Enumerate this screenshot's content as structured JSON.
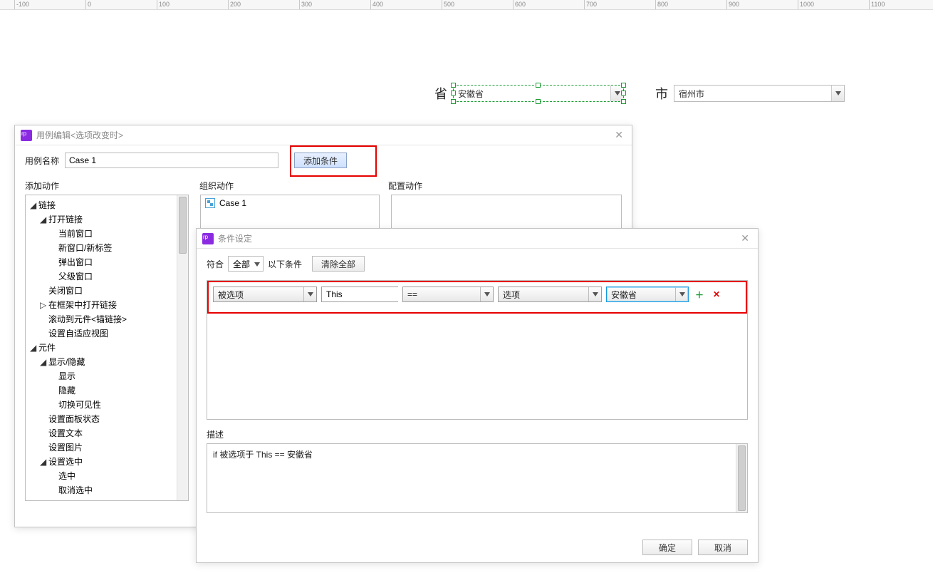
{
  "ruler": {
    "start": -100,
    "step": 100,
    "count": 16
  },
  "canvas": {
    "left": {
      "label": "省",
      "value": "安徽省"
    },
    "right": {
      "label": "市",
      "value": "宿州市"
    }
  },
  "caseDialog": {
    "title": "用例编辑<选项改变时>",
    "nameLabel": "用例名称",
    "nameValue": "Case 1",
    "addConditionBtn": "添加条件",
    "headers": {
      "a": "添加动作",
      "b": "组织动作",
      "c": "配置动作"
    },
    "tree": [
      {
        "label": "链接",
        "exp": true,
        "children": [
          {
            "label": "打开链接",
            "exp": true,
            "children": [
              {
                "label": "当前窗口"
              },
              {
                "label": "新窗口/新标签"
              },
              {
                "label": "弹出窗口"
              },
              {
                "label": "父级窗口"
              }
            ]
          },
          {
            "label": "关闭窗口"
          },
          {
            "label": "在框架中打开链接",
            "hasChildren": true
          },
          {
            "label": "滚动到元件<锚链接>"
          },
          {
            "label": "设置自适应视图"
          }
        ]
      },
      {
        "label": "元件",
        "exp": true,
        "children": [
          {
            "label": "显示/隐藏",
            "exp": true,
            "children": [
              {
                "label": "显示"
              },
              {
                "label": "隐藏"
              },
              {
                "label": "切换可见性"
              }
            ]
          },
          {
            "label": "设置面板状态"
          },
          {
            "label": "设置文本"
          },
          {
            "label": "设置图片"
          },
          {
            "label": "设置选中",
            "exp": true,
            "children": [
              {
                "label": "选中"
              },
              {
                "label": "取消选中"
              }
            ]
          }
        ]
      }
    ],
    "organize": {
      "caseName": "Case 1"
    }
  },
  "condDialog": {
    "title": "条件设定",
    "matchLabel": "符合",
    "matchValue": "全部",
    "matchSuffix": "以下条件",
    "clearAllBtn": "清除全部",
    "row": {
      "field": "被选项",
      "target": "This",
      "op": "==",
      "rightType": "选项",
      "value": "安徽省"
    },
    "descLabel": "描述",
    "descText": "if 被选项于 This == 安徽省",
    "okBtn": "确定",
    "cancelBtn": "取消"
  }
}
